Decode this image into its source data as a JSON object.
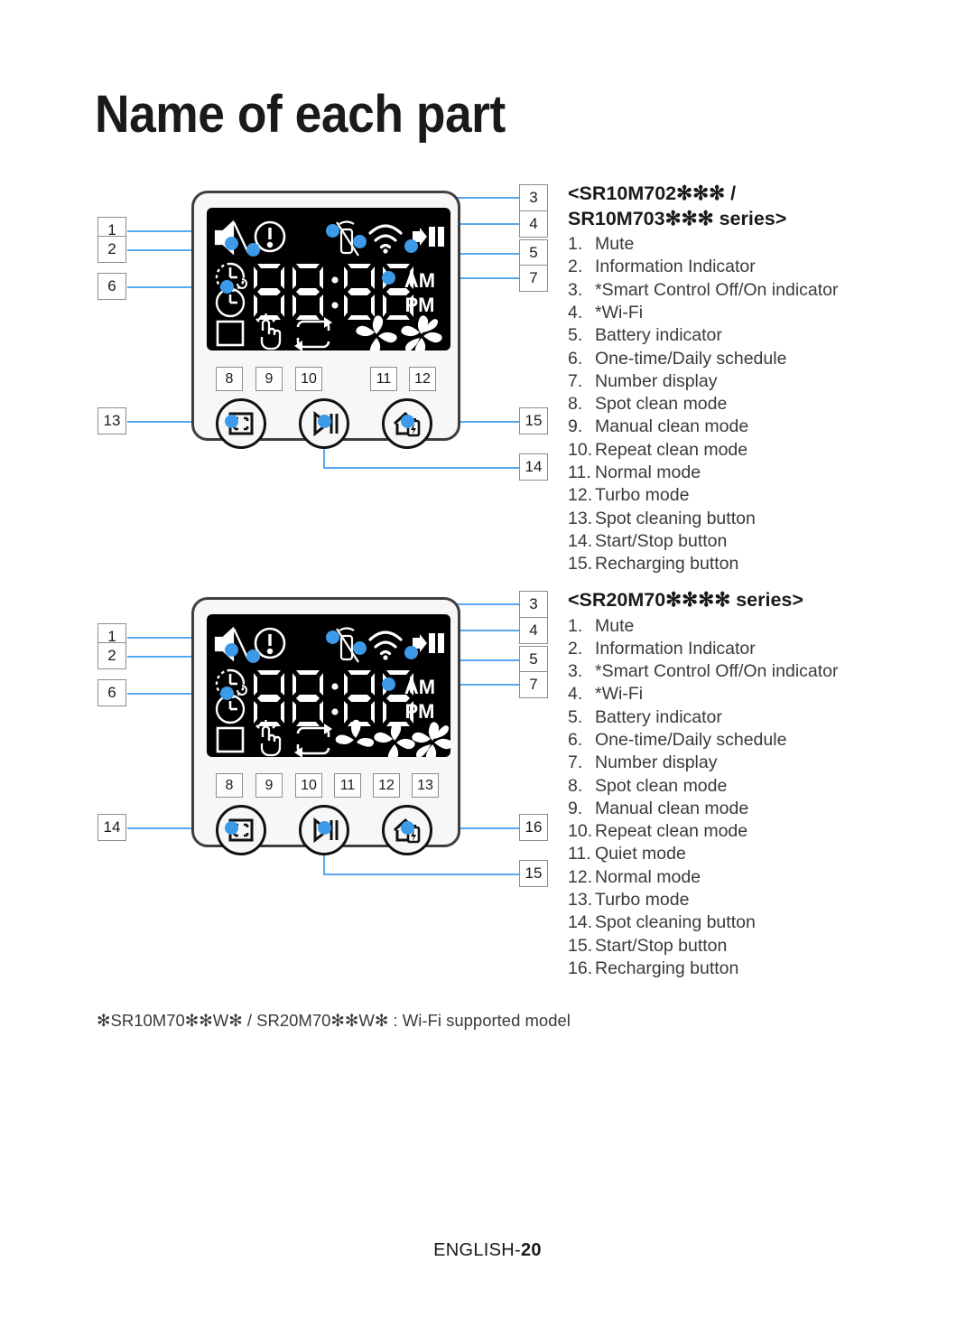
{
  "title": "Name of each part",
  "footnote": "✻SR10M70✻✻W✻ / SR20M70✻✻W✻ : Wi-Fi supported model",
  "footer": {
    "language": "ENGLISH-",
    "page": "20"
  },
  "colors": {
    "leader": "#5aa9ef",
    "dot": "#3d9ae8",
    "panel_border": "#3f3f3f",
    "lcd_background": "#000000",
    "lcd_foreground": "#ffffff",
    "callout_border": "#8c8c8c",
    "text": "#3a3a3a"
  },
  "devices": [
    {
      "heading": "<SR10M702✻✻✻ /\nSR10M703✻✻✻ series>",
      "items": [
        {
          "num": "1.",
          "label": "Mute"
        },
        {
          "num": "2.",
          "label": "Information Indicator"
        },
        {
          "num": "3.",
          "label": "*Smart Control Off/On indicator"
        },
        {
          "num": "4.",
          "label": "*Wi-Fi"
        },
        {
          "num": "5.",
          "label": "Battery indicator"
        },
        {
          "num": "6.",
          "label": "One-time/Daily schedule"
        },
        {
          "num": "7.",
          "label": "Number display"
        },
        {
          "num": "8.",
          "label": "Spot clean mode"
        },
        {
          "num": "9.",
          "label": "Manual clean mode"
        },
        {
          "num": "10.",
          "label": "Repeat clean mode"
        },
        {
          "num": "11.",
          "label": "Normal mode"
        },
        {
          "num": "12.",
          "label": "Turbo mode"
        },
        {
          "num": "13.",
          "label": "Spot cleaning button"
        },
        {
          "num": "14.",
          "label": "Start/Stop button"
        },
        {
          "num": "15.",
          "label": "Recharging button"
        }
      ],
      "callouts_left": [
        "1",
        "2",
        "6"
      ],
      "callouts_right": [
        "3",
        "4",
        "5",
        "7"
      ],
      "callouts_modes": [
        "8",
        "9",
        "10",
        "11",
        "12"
      ],
      "callout_button_left": "13",
      "callout_button_right": "15",
      "callout_button_bottom": "14",
      "display": {
        "digits": "88:88",
        "am": "AM",
        "pm": "PM"
      }
    },
    {
      "heading": "<SR20M70✻✻✻✻ series>",
      "items": [
        {
          "num": "1.",
          "label": "Mute"
        },
        {
          "num": "2.",
          "label": "Information Indicator"
        },
        {
          "num": "3.",
          "label": "*Smart Control Off/On indicator"
        },
        {
          "num": "4.",
          "label": "*Wi-Fi"
        },
        {
          "num": "5.",
          "label": "Battery indicator"
        },
        {
          "num": "6.",
          "label": "One-time/Daily schedule"
        },
        {
          "num": "7.",
          "label": "Number display"
        },
        {
          "num": "8.",
          "label": "Spot clean mode"
        },
        {
          "num": "9.",
          "label": "Manual clean mode"
        },
        {
          "num": "10.",
          "label": "Repeat clean mode"
        },
        {
          "num": "11.",
          "label": "Quiet mode"
        },
        {
          "num": "12.",
          "label": "Normal mode"
        },
        {
          "num": "13.",
          "label": "Turbo mode"
        },
        {
          "num": "14.",
          "label": "Spot cleaning button"
        },
        {
          "num": "15.",
          "label": "Start/Stop button"
        },
        {
          "num": "16.",
          "label": "Recharging button"
        }
      ],
      "callouts_left": [
        "1",
        "2",
        "6"
      ],
      "callouts_right": [
        "3",
        "4",
        "5",
        "7"
      ],
      "callouts_modes": [
        "8",
        "9",
        "10",
        "11",
        "12",
        "13"
      ],
      "callout_button_left": "14",
      "callout_button_right": "16",
      "callout_button_bottom": "15",
      "display": {
        "digits": "88:88",
        "am": "AM",
        "pm": "PM"
      }
    }
  ],
  "icons": {
    "mute": "mute-icon",
    "information": "information-icon",
    "smart_control": "smart-control-icon",
    "wifi": "wifi-icon",
    "battery": "battery-icon",
    "one_time_schedule": "one-time-schedule-icon",
    "daily_schedule": "daily-schedule-icon",
    "spot_clean": "spot-clean-icon",
    "manual_clean": "manual-clean-icon",
    "repeat_clean": "repeat-clean-icon",
    "quiet_mode": "quiet-fan-icon",
    "normal_mode": "normal-fan-icon",
    "turbo_mode": "turbo-fan-icon",
    "spot_button": "spot-clean-button-icon",
    "start_stop_button": "play-pause-icon",
    "recharge_button": "home-recharge-icon"
  }
}
